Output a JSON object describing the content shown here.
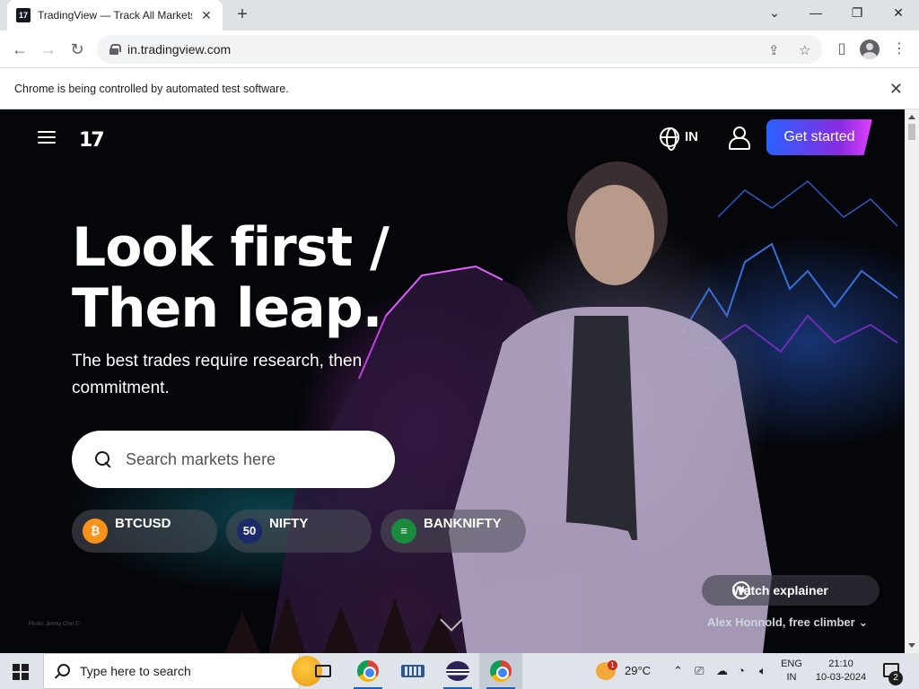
{
  "browser": {
    "tab_title": "TradingView — Track All Markets",
    "tab_favicon": "17",
    "tab_close": "✕",
    "new_tab": "+",
    "url": "in.tradingview.com",
    "win_minimize": "—",
    "win_restore": "❐",
    "win_close": "✕",
    "win_tabsearch": "⌄",
    "infobar_text": "Chrome is being controlled by automated test software.",
    "infobar_close": "✕"
  },
  "header": {
    "logo": "17",
    "region": "IN",
    "cta": "Get started"
  },
  "hero": {
    "headline_1": "Look first /",
    "headline_2": "Then leap.",
    "subhead": "The best trades require research, then commitment.",
    "search_placeholder": "Search markets here",
    "chips": [
      {
        "label": "BTCUSD",
        "icon_text": "₿",
        "icon_color": "#f7931a"
      },
      {
        "label": "NIFTY",
        "icon_text": "50",
        "icon_color": "#1c2a6b"
      },
      {
        "label": "BANKNIFTY",
        "icon_text": "≡",
        "icon_color": "#1b8a3c"
      }
    ],
    "watch_label": "Watch explainer",
    "caption": "Alex Honnold, free climber ⌄",
    "photo_credit": "Photo: Jimmy Chin ©"
  },
  "taskbar": {
    "search_placeholder": "Type here to search",
    "weather_badge": "1",
    "temperature": "29°C",
    "lang_1": "ENG",
    "lang_2": "IN",
    "time": "21:10",
    "date": "10-03-2024",
    "notifications": "2"
  },
  "colors": {
    "cta_start": "#2962ff",
    "cta_end": "#e040fb",
    "page_bg": "#05060a"
  }
}
